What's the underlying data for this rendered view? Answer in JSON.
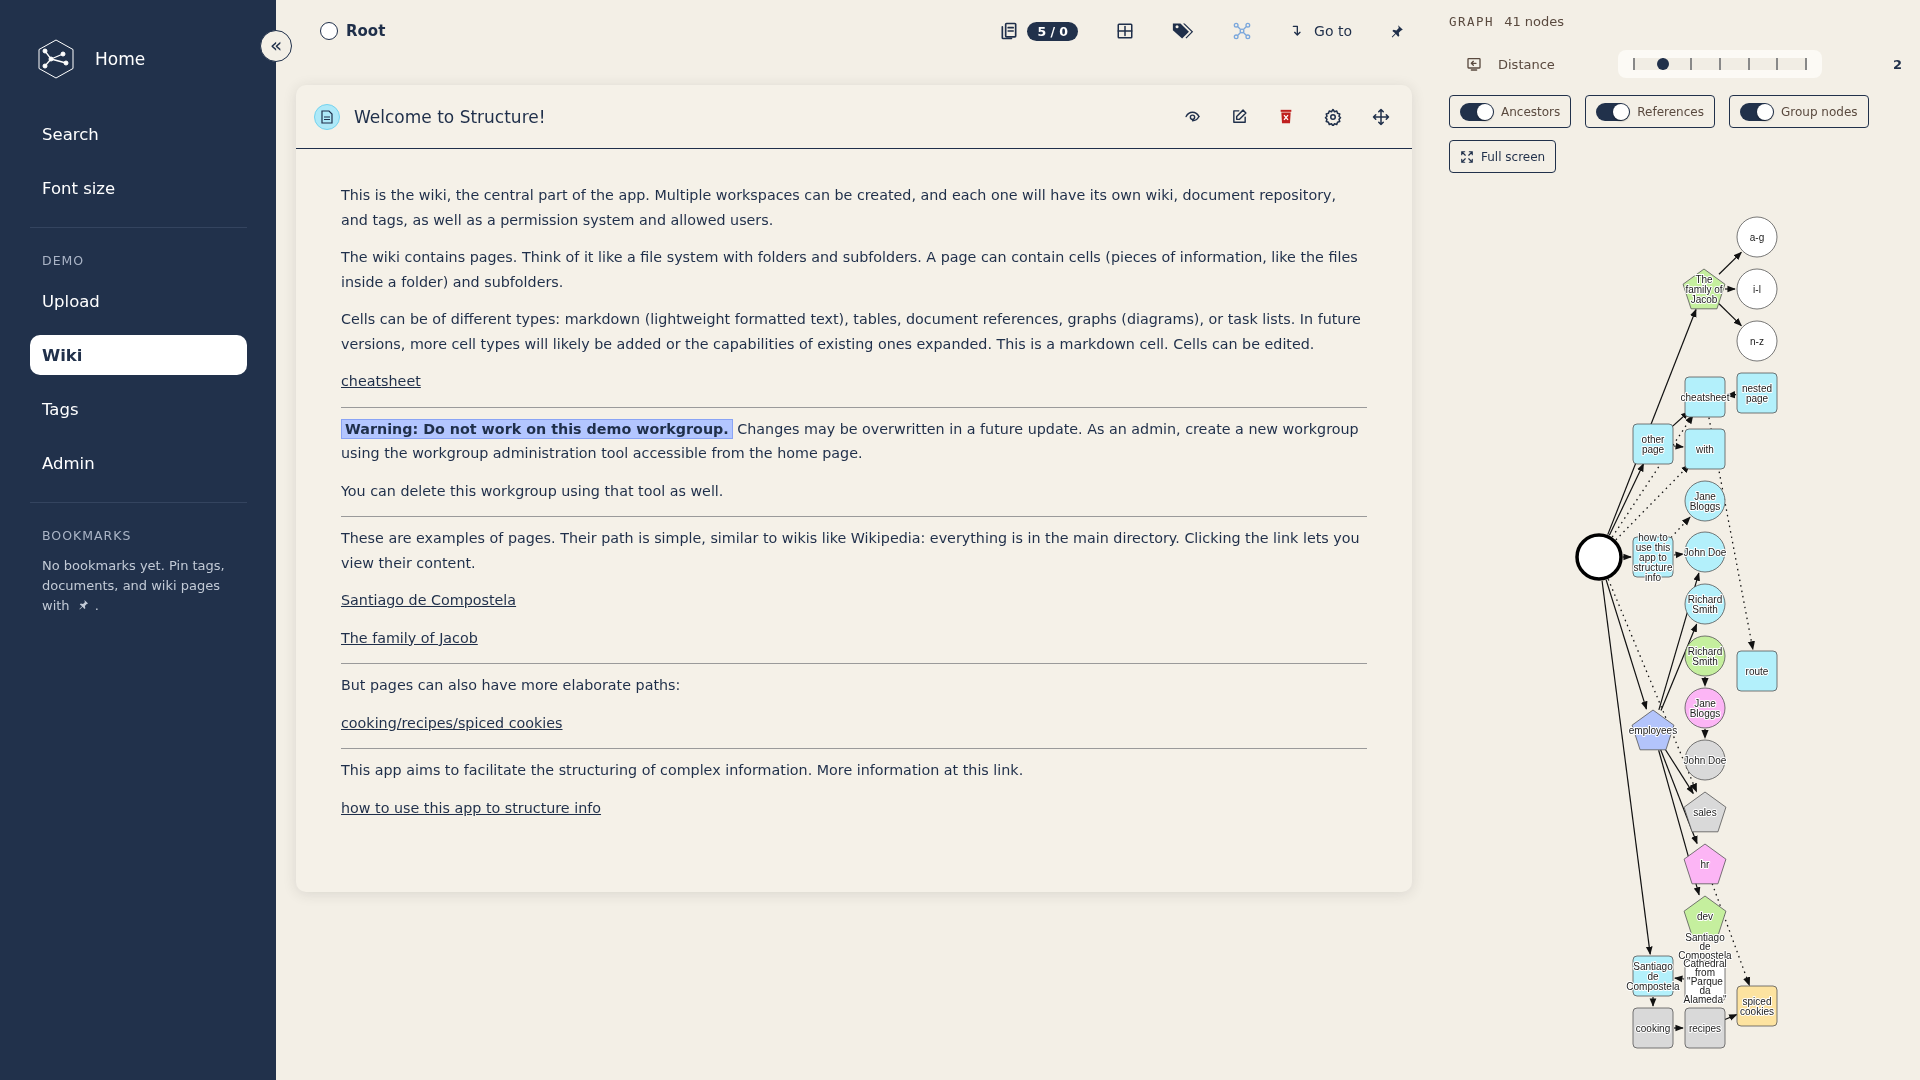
{
  "sidebar": {
    "home": "Home",
    "collapse": "«",
    "top_items": [
      {
        "label": "Search",
        "selected": false
      },
      {
        "label": "Font size",
        "selected": false
      }
    ],
    "sections": [
      {
        "heading": "DEMO",
        "items": [
          {
            "label": "Upload",
            "selected": false
          },
          {
            "label": "Wiki",
            "selected": true
          },
          {
            "label": "Tags",
            "selected": false
          },
          {
            "label": "Admin",
            "selected": false
          }
        ]
      }
    ],
    "bookmarks": {
      "heading": "BOOKMARKS",
      "text": "No bookmarks yet. Pin tags, documents, and wiki pages",
      "text_end": "with",
      "suffix": "."
    }
  },
  "topbar": {
    "path": "Root",
    "counter": "5 / 0",
    "goto": "Go to"
  },
  "document": {
    "title": "Welcome to Structure!",
    "blocks": [
      {
        "kind": "paragraph",
        "text": "This is the wiki, the central part of the app. Multiple workspaces can be created, and each one will have its own wiki, document repository, and tags, as well as a permission system and allowed users."
      },
      {
        "kind": "paragraph",
        "text": "The wiki contains pages. Think of it like a file system with folders and subfolders. A page can contain cells (pieces of information, like the files inside a folder) and subfolders."
      },
      {
        "kind": "paragraph",
        "text": "Cells can be of different types: markdown (lightweight formatted text), tables, document references, graphs (diagrams), or task lists. In future versions, more cell types will likely be added or the capabilities of existing ones expanded. This is a markdown cell. Cells can be edited."
      },
      {
        "kind": "link",
        "text": "cheatsheet"
      },
      {
        "kind": "rule"
      },
      {
        "kind": "warning",
        "text": "**Warning: Do not work on this demo workgroup.** Changes may be overwritten in a future update. As an admin, create a new workgroup using the workgroup administration tool accessible from the home page."
      },
      {
        "kind": "paragraph",
        "text": "You can delete this workgroup using that tool as well."
      },
      {
        "kind": "rule"
      },
      {
        "kind": "paragraph",
        "text": "These are examples of pages. Their path is simple, similar to wikis like Wikipedia: everything is in the main directory. Clicking the link lets you view their content."
      },
      {
        "kind": "link",
        "text": "Santiago de Compostela"
      },
      {
        "kind": "link",
        "text": "The family of Jacob"
      },
      {
        "kind": "rule"
      },
      {
        "kind": "paragraph",
        "text": "But pages can also have more elaborate paths:"
      },
      {
        "kind": "link",
        "text": "cooking/recipes/spiced cookies"
      },
      {
        "kind": "rule"
      },
      {
        "kind": "paragraph",
        "text": "This app aims to facilitate the structuring of complex information. More information at this link."
      },
      {
        "kind": "link",
        "text": "how to use this app to structure info"
      }
    ]
  },
  "graph": {
    "heading": "GRAPH",
    "count": "41 nodes",
    "distance": {
      "label": "Distance",
      "level": 0.167,
      "reading": "2"
    },
    "toggles": [
      {
        "label": "Ancestors",
        "on": true
      },
      {
        "label": "References",
        "on": true
      },
      {
        "label": "Group nodes",
        "on": true
      }
    ],
    "fullscreen": "Full screen",
    "nodes": [
      {
        "kind": "root"
      },
      {
        "kind": "circle",
        "label": "a-g",
        "color": "#ffffff"
      },
      {
        "kind": "circle",
        "label": "i-l",
        "color": "#ffffff"
      },
      {
        "kind": "circle",
        "label": "n-z",
        "color": "#ffffff"
      },
      {
        "kind": "pentagon",
        "label": "The family of Jacob",
        "color": "#c5ef9e"
      },
      {
        "kind": "rect",
        "label": "cheatsheet",
        "color": "#b3f0fb"
      },
      {
        "kind": "rect",
        "label": "nested page",
        "color": "#b3f0fb"
      },
      {
        "kind": "rect",
        "label": "other page",
        "color": "#b3f0fb"
      },
      {
        "kind": "rect",
        "label": "with",
        "color": "#b3f0fb"
      },
      {
        "kind": "circle",
        "label": "Jane Bloggs",
        "color": "#b3f0fb"
      },
      {
        "kind": "rect",
        "label": "how to use this app to structure info",
        "color": "#b3f0fb"
      },
      {
        "kind": "circle",
        "label": "John Doe",
        "color": "#b3f0fb"
      },
      {
        "kind": "circle",
        "label": "Richard Smith",
        "color": "#b3f0fb"
      },
      {
        "kind": "circle",
        "label": "Richard Smith",
        "color": "#c5ef9e"
      },
      {
        "kind": "rect",
        "label": "route",
        "color": "#b3f0fb"
      },
      {
        "kind": "circle",
        "label": "Jane Bloggs",
        "color": "#fcb5f5"
      },
      {
        "kind": "pentagon",
        "label": "employees",
        "color": "#b3c4fb"
      },
      {
        "kind": "circle",
        "label": "John Doe",
        "color": "#d9d9d9"
      },
      {
        "kind": "pentagon",
        "label": "sales",
        "color": "#d9d9d9"
      },
      {
        "kind": "pentagon",
        "label": "hr",
        "color": "#fcb5f5"
      },
      {
        "kind": "pentagon",
        "label": "dev",
        "color": "#c5ef9e"
      },
      {
        "kind": "rect",
        "label": "Santiago de Compostela",
        "color": "#b3f0fb"
      },
      {
        "kind": "rect",
        "label": "Santiago de Compostela Cathedral from \"Parque da Alameda\"",
        "color": "#ffffff"
      },
      {
        "kind": "rect",
        "label": "spiced cookies",
        "color": "#fde3a0"
      },
      {
        "kind": "rect",
        "label": "cooking",
        "color": "#d9d9d9"
      },
      {
        "kind": "rect",
        "label": "recipes",
        "color": "#d9d9d9"
      }
    ]
  }
}
